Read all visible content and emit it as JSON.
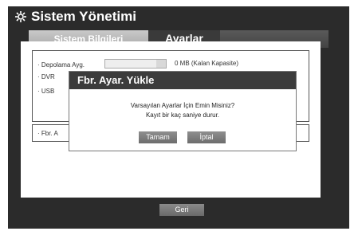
{
  "window": {
    "title": "Sistem Yönetimi",
    "icon": "gear-icon"
  },
  "tabs": [
    {
      "label": "Sistem Bilgileri",
      "active": false
    },
    {
      "label": "Ayarlar",
      "active": true
    }
  ],
  "settings": {
    "storage_label": "· Depolama Ayg.",
    "dvr_label": "· DVR",
    "usb_label": "· USB",
    "capacity_text": "0 MB (Kalan Kapasite)",
    "factory_label": "· Fbr. A"
  },
  "footer": {
    "back_label": "Geri"
  },
  "dialog": {
    "title": "Fbr. Ayar. Yükle",
    "message_line1": "Varsayılan Ayarlar İçin Emin Misiniz?",
    "message_line2": "Kayıt bir kaç saniye durur.",
    "ok_label": "Tamam",
    "cancel_label": "İptal"
  },
  "colors": {
    "frame": "#2b2b2b",
    "dialog_header": "#3c3c3c",
    "button": "#7a7a7a"
  }
}
